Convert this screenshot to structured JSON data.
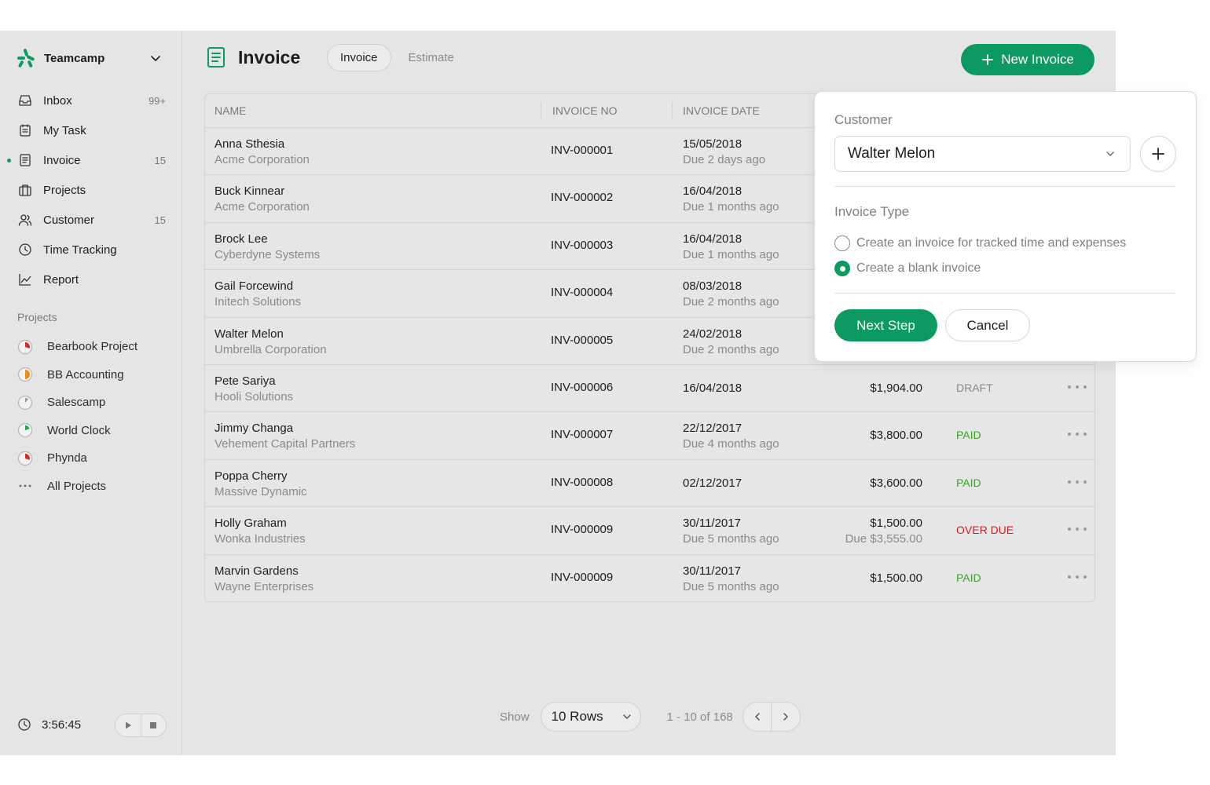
{
  "brand": {
    "name": "Teamcamp"
  },
  "nav": [
    {
      "label": "Inbox",
      "count": "99+",
      "icon": "inbox-icon"
    },
    {
      "label": "My Task",
      "count": "",
      "icon": "task-icon"
    },
    {
      "label": "Invoice",
      "count": "15",
      "icon": "invoice-icon",
      "active": true
    },
    {
      "label": "Projects",
      "count": "",
      "icon": "briefcase-icon"
    },
    {
      "label": "Customer",
      "count": "15",
      "icon": "users-icon"
    },
    {
      "label": "Time Tracking",
      "count": "",
      "icon": "clock-icon"
    },
    {
      "label": "Report",
      "count": "",
      "icon": "chart-icon"
    }
  ],
  "projects": {
    "heading": "Projects",
    "items": [
      {
        "label": "Bearbook Project",
        "color": "#d62b2b",
        "progress": 0.3
      },
      {
        "label": "BB Accounting",
        "color": "#f08a1c",
        "progress": 0.5
      },
      {
        "label": "Salescamp",
        "color": "#9a9a9a",
        "progress": 0.12
      },
      {
        "label": "World Clock",
        "color": "#22a04a",
        "progress": 0.2
      },
      {
        "label": "Phynda",
        "color": "#d62b2b",
        "progress": 0.3
      }
    ],
    "all_label": "All Projects"
  },
  "timer": {
    "time": "3:56:45"
  },
  "header": {
    "title": "Invoice",
    "tabs": [
      "Invoice",
      "Estimate"
    ],
    "new_button": "New Invoice"
  },
  "table": {
    "columns": [
      "NAME",
      "INVOICE NO",
      "INVOICE DATE"
    ],
    "rows": [
      {
        "name": "Anna Sthesia",
        "company": "Acme Corporation",
        "no": "INV-000001",
        "date": "15/05/2018",
        "due": "Due 2 days ago",
        "amount": "",
        "amount_due": "",
        "status": "",
        "status_color": ""
      },
      {
        "name": "Buck Kinnear",
        "company": "Acme Corporation",
        "no": "INV-000002",
        "date": "16/04/2018",
        "due": "Due 1 months ago",
        "amount": "",
        "amount_due": "",
        "status": "",
        "status_color": ""
      },
      {
        "name": "Brock Lee",
        "company": "Cyberdyne Systems",
        "no": "INV-000003",
        "date": "16/04/2018",
        "due": "Due 1 months ago",
        "amount": "",
        "amount_due": "",
        "status": "",
        "status_color": ""
      },
      {
        "name": "Gail Forcewind",
        "company": "Initech Solutions",
        "no": "INV-000004",
        "date": "08/03/2018",
        "due": "Due 2 months ago",
        "amount": "",
        "amount_due": "",
        "status": "",
        "status_color": ""
      },
      {
        "name": "Walter Melon",
        "company": "Umbrella Corporation",
        "no": "INV-000005",
        "date": "24/02/2018",
        "due": "Due 2 months ago",
        "amount": "",
        "amount_due": "",
        "status": "",
        "status_color": ""
      },
      {
        "name": "Pete Sariya",
        "company": "Hooli Solutions",
        "no": "INV-000006",
        "date": "16/04/2018",
        "due": "",
        "amount": "$1,904.00",
        "amount_due": "",
        "status": "DRAFT",
        "status_color": "#8a8a8a"
      },
      {
        "name": "Jimmy Changa",
        "company": "Vehement Capital Partners",
        "no": "INV-000007",
        "date": "22/12/2017",
        "due": "Due 4 months ago",
        "amount": "$3,800.00",
        "amount_due": "",
        "status": "PAID",
        "status_color": "#3aa329"
      },
      {
        "name": "Poppa Cherry",
        "company": "Massive Dynamic",
        "no": "INV-000008",
        "date": "02/12/2017",
        "due": "",
        "amount": "$3,600.00",
        "amount_due": "",
        "status": "PAID",
        "status_color": "#3aa329"
      },
      {
        "name": "Holly Graham",
        "company": "Wonka Industries",
        "no": "INV-000009",
        "date": "30/11/2017",
        "due": "Due 5 months ago",
        "amount": "$1,500.00",
        "amount_due": "Due $3,555.00",
        "status": "OVER DUE",
        "status_color": "#d11f1f"
      },
      {
        "name": "Marvin Gardens",
        "company": "Wayne Enterprises",
        "no": "INV-000009",
        "date": "30/11/2017",
        "due": "Due 5 months ago",
        "amount": "$1,500.00",
        "amount_due": "",
        "status": "PAID",
        "status_color": "#3aa329"
      }
    ]
  },
  "pagination": {
    "show_label": "Show",
    "rows_value": "10 Rows",
    "range": "1 - 10 of 168"
  },
  "popover": {
    "customer_label": "Customer",
    "customer_value": "Walter Melon",
    "type_label": "Invoice Type",
    "options": [
      "Create an invoice for tracked time and expenses",
      "Create a blank invoice"
    ],
    "selected_option": 1,
    "next_label": "Next Step",
    "cancel_label": "Cancel"
  },
  "colors": {
    "accent": "#0d9a62",
    "paid": "#3aa329",
    "overdue": "#d11f1f"
  }
}
